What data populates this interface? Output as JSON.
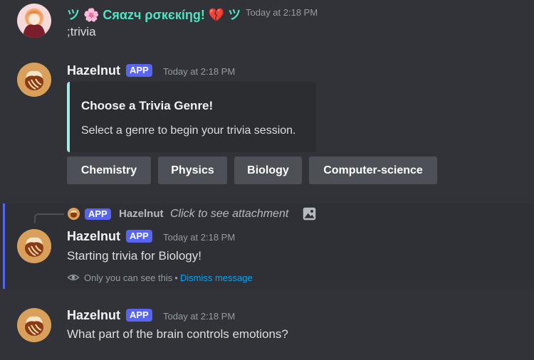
{
  "messages": [
    {
      "username": "ツ 🌸 Cяαzч ρσкєкíηg! 💔 ツ",
      "timestamp": "Today at 2:18 PM",
      "text": ";trivia"
    },
    {
      "username": "Hazelnut",
      "tag": "APP",
      "timestamp": "Today at 2:18 PM",
      "embed": {
        "title": "Choose a Trivia Genre!",
        "description": "Select a genre to begin your trivia session.",
        "accent_color": "#a3e9e4"
      },
      "buttons": [
        "Chemistry",
        "Physics",
        "Biology",
        "Computer-science"
      ]
    },
    {
      "reply": {
        "tag": "APP",
        "username": "Hazelnut",
        "text": "Click to see attachment",
        "icon": "image-icon"
      },
      "username": "Hazelnut",
      "tag": "APP",
      "timestamp": "Today at 2:18 PM",
      "text": "Starting trivia for Biology!",
      "ephemeral": {
        "notice": "Only you can see this",
        "separator": "•",
        "dismiss": "Dismiss message"
      }
    },
    {
      "username": "Hazelnut",
      "tag": "APP",
      "timestamp": "Today at 2:18 PM",
      "text": "What part of the brain controls emotions?"
    }
  ],
  "colors": {
    "background": "#313338",
    "app_tag": "#5865f2",
    "button": "#4e5058",
    "link": "#00a8fc",
    "crazy_username": "#4fe3c1"
  }
}
